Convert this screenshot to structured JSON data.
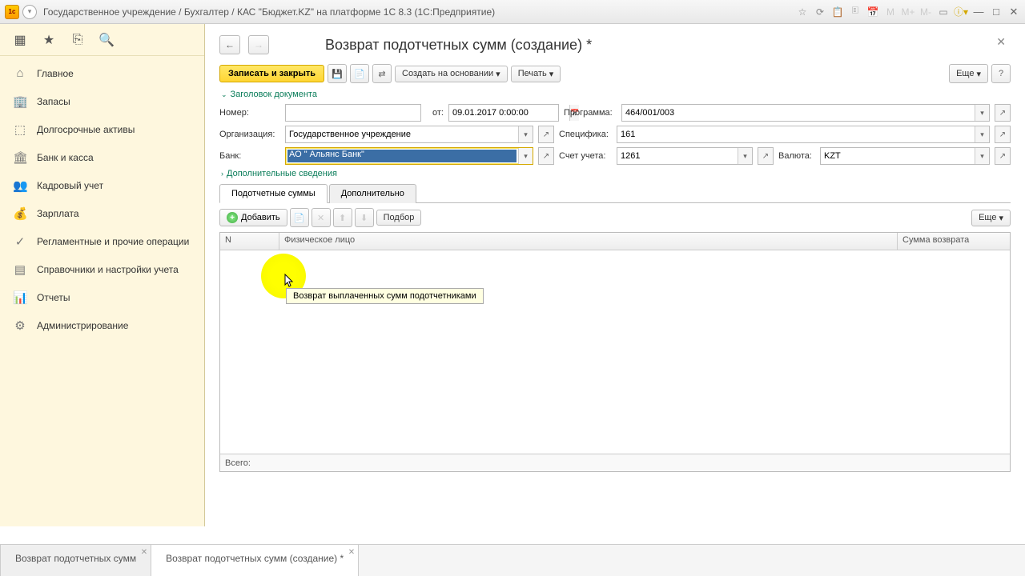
{
  "titlebar": {
    "title": "Государственное учреждение / Бухгалтер / КАС \"Бюджет.KZ\" на платформе 1С 8.3  (1С:Предприятие)",
    "m_labels": [
      "M",
      "M+",
      "M-"
    ]
  },
  "sidebar": {
    "items": [
      {
        "icon": "home",
        "label": "Главное"
      },
      {
        "icon": "warehouse",
        "label": "Запасы"
      },
      {
        "icon": "assets",
        "label": "Долгосрочные активы"
      },
      {
        "icon": "bank",
        "label": "Банк и касса"
      },
      {
        "icon": "hr",
        "label": "Кадровый учет"
      },
      {
        "icon": "salary",
        "label": "Зарплата"
      },
      {
        "icon": "ops",
        "label": "Регламентные и прочие операции"
      },
      {
        "icon": "refs",
        "label": "Справочники и настройки учета"
      },
      {
        "icon": "reports",
        "label": "Отчеты"
      },
      {
        "icon": "admin",
        "label": "Администрирование"
      }
    ]
  },
  "document": {
    "title": "Возврат подотчетных сумм (создание) *"
  },
  "toolbar": {
    "save_close": "Записать и закрыть",
    "create_based": "Создать на основании",
    "print": "Печать",
    "more": "Еще"
  },
  "sections": {
    "header": "Заголовок документа",
    "additional": "Дополнительные сведения"
  },
  "form": {
    "number_label": "Номер:",
    "number_value": "",
    "date_label": "от:",
    "date_value": "09.01.2017 0:00:00",
    "program_label": "Программа:",
    "program_value": "464/001/003",
    "org_label": "Организация:",
    "org_value": "Государственное учреждение",
    "spec_label": "Специфика:",
    "spec_value": "161",
    "bank_label": "Банк:",
    "bank_value": "АО \" Альянс Банк\"",
    "account_label": "Счет учета:",
    "account_value": "1261",
    "currency_label": "Валюта:",
    "currency_value": "KZT"
  },
  "tabs": {
    "tab1": "Подотчетные суммы",
    "tab2": "Дополнительно"
  },
  "table_toolbar": {
    "add": "Добавить",
    "select": "Подбор",
    "more": "Еще"
  },
  "table": {
    "cols": {
      "n": "N",
      "person": "Физическое лицо",
      "sum": "Сумма возврата"
    },
    "footer": "Всего:"
  },
  "tooltip": "Возврат выплаченных сумм подотчетниками",
  "bottom_tabs": {
    "tab1": "Возврат подотчетных сумм",
    "tab2": "Возврат подотчетных сумм (создание) *"
  }
}
